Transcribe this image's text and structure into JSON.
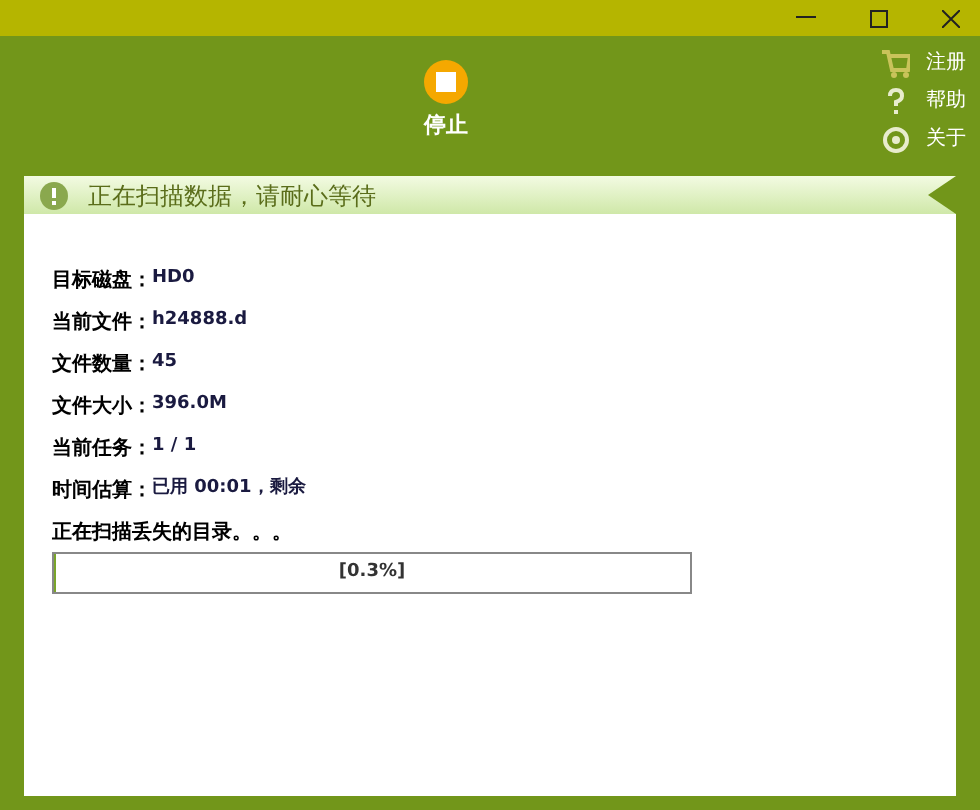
{
  "toolbar": {
    "stop_label": "停止"
  },
  "side_menu": [
    {
      "kind": "cart",
      "label": "注册"
    },
    {
      "kind": "help",
      "label": "帮助"
    },
    {
      "kind": "about",
      "label": "关于"
    }
  ],
  "banner": {
    "text": "正在扫描数据，请耐心等待"
  },
  "info_rows": [
    {
      "label": "目标磁盘：",
      "value": "HD0"
    },
    {
      "label": "当前文件：",
      "value": "h24888.d"
    },
    {
      "label": "文件数量：",
      "value": "45"
    },
    {
      "label": "文件大小：",
      "value": "396.0M"
    },
    {
      "label": "当前任务：",
      "value": "1 / 1"
    },
    {
      "label": "时间估算：",
      "value": "已用 00:01，剩余"
    }
  ],
  "status_text": "正在扫描丢失的目录。。。",
  "progress": {
    "level": 0.003,
    "text": "[0.3%]"
  }
}
